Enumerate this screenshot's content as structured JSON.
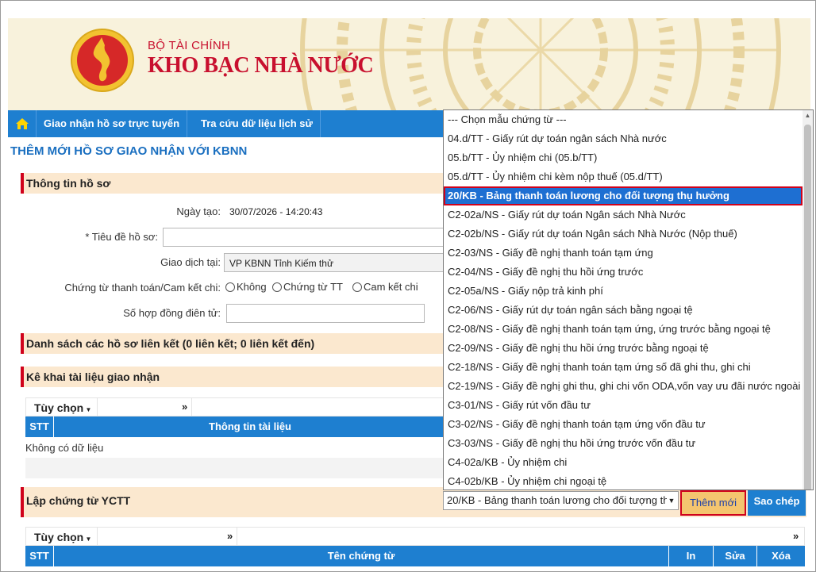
{
  "header": {
    "ministry": "BỘ TÀI CHÍNH",
    "agency": "KHO BẠC NHÀ NƯỚC"
  },
  "nav": {
    "home_icon": "home-icon",
    "items": [
      "Giao nhận hồ sơ trực tuyến",
      "Tra cứu dữ liệu lịch sử"
    ]
  },
  "page_title": "THÊM MỚI HỒ SƠ GIAO NHẬN VỚI KBNN",
  "profile": {
    "section_title": "Thông tin hồ sơ",
    "created_label": "Ngày tạo:",
    "created_value": "30/07/2026 - 14:20:43",
    "title_label": "* Tiêu đề hồ sơ:",
    "title_value": "",
    "transaction_label": "Giao dịch tại:",
    "transaction_value": "VP KBNN Tỉnh Kiếm thử",
    "payment_label": "Chứng từ thanh toán/Cam kết chi:",
    "payment_options": [
      "Không",
      "Chứng từ TT",
      "Cam kết chi"
    ],
    "contract_label": "Số hợp đồng điên tử:",
    "contract_value": ""
  },
  "linked": {
    "section_title": "Danh sách các hồ sơ liên kết (0 liên kết; 0 liên kết đến)"
  },
  "documents": {
    "section_title": "Kê khai tài liệu giao nhận",
    "options_label": "Tùy chọn",
    "expand_glyph": "»",
    "columns": [
      "STT",
      "Thông tin tài liệu"
    ],
    "empty_text": "Không có dữ liệu"
  },
  "vouchers": {
    "section_title": "Lập chứng từ YCTT",
    "options_label": "Tùy chọn",
    "expand_glyph": "»",
    "columns": [
      "STT",
      "Tên chứng từ",
      "In",
      "Sửa",
      "Xóa"
    ],
    "selected_template": "20/KB - Bảng thanh toán lương cho đối tượng thụ hưởng",
    "add_button": "Thêm mới",
    "copy_button": "Sao chép"
  },
  "template_list": {
    "selected_index": 4,
    "options": [
      "--- Chọn mẫu chứng từ ---",
      "04.d/TT - Giấy rút dự toán ngân sách Nhà nước",
      "05.b/TT - Ủy nhiệm chi (05.b/TT)",
      "05.d/TT - Ủy nhiệm chi kèm nộp thuế (05.d/TT)",
      "20/KB - Bảng thanh toán lương cho đối tượng thụ hưởng",
      "C2-02a/NS - Giấy rút dự toán Ngân sách Nhà Nước",
      "C2-02b/NS - Giấy rút dự toán Ngân sách Nhà Nước (Nộp thuế)",
      "C2-03/NS - Giấy đề nghị thanh toán tạm ứng",
      "C2-04/NS - Giấy đề nghị thu hồi ứng trước",
      "C2-05a/NS - Giấy nộp trả kinh phí",
      "C2-06/NS - Giấy rút dự toán ngân sách bằng ngoại tệ",
      "C2-08/NS - Giấy đề nghị thanh toán tạm ứng, ứng trước bằng ngoại tệ",
      "C2-09/NS - Giấy đề nghị thu hồi ứng trước bằng ngoại tệ",
      "C2-18/NS - Giấy đề nghị thanh toán tạm ứng số đã ghi thu, ghi chi",
      "C2-19/NS - Giấy đề nghị ghi thu, ghi chi vốn ODA,vốn vay ưu đãi nước ngoài",
      "C3-01/NS - Giấy rút vốn đầu tư",
      "C3-02/NS - Giấy đề nghị thanh toán tạm ứng vốn đầu tư",
      "C3-03/NS - Giấy đề nghị thu hồi ứng trước vốn đầu tư",
      "C4-02a/KB - Ủy nhiệm chi",
      "C4-02b/KB - Ủy nhiệm chi ngoại tệ"
    ]
  },
  "colors": {
    "brand_red": "#c8102e",
    "nav_blue": "#1e7fd0",
    "section_bg": "#fbe8cf",
    "highlight": "#d0021b"
  }
}
